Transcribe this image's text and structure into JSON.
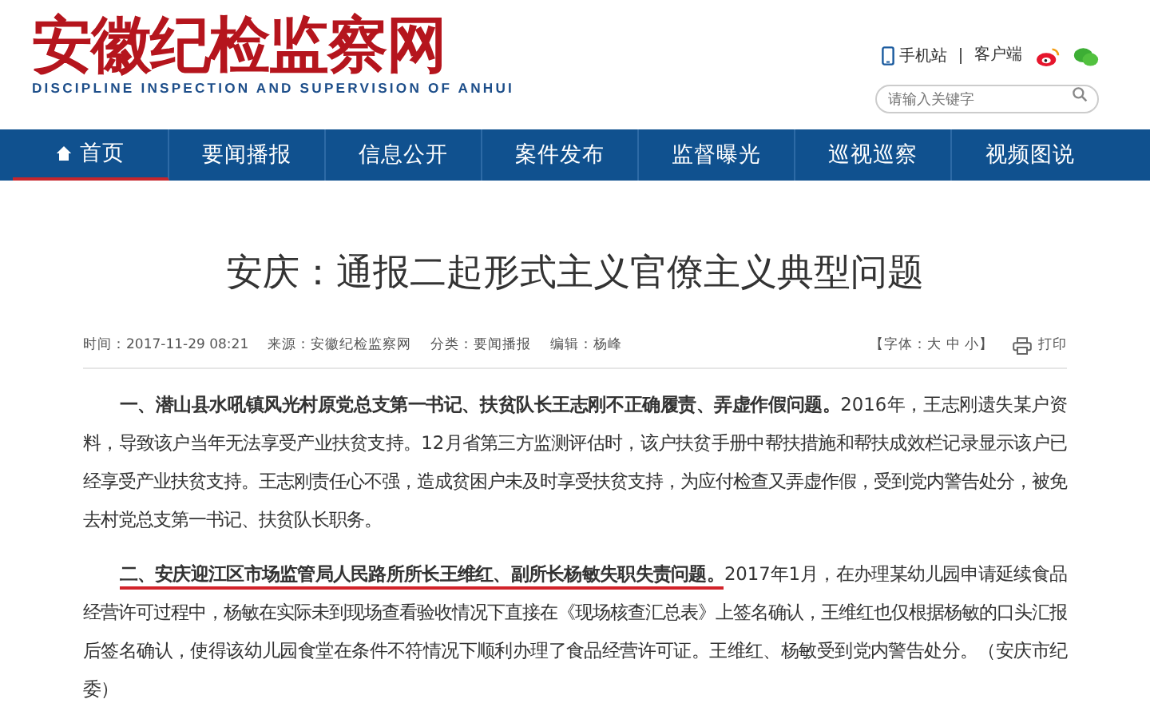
{
  "site": {
    "name": "安徽纪检监察网",
    "subtitle": "DISCIPLINE INSPECTION AND SUPERVISION OF ANHUI"
  },
  "top_links": [
    {
      "kind": "phone",
      "label": "手机站"
    },
    {
      "kind": "text",
      "label": "客户端"
    },
    {
      "kind": "weibo"
    },
    {
      "kind": "wechat"
    }
  ],
  "search": {
    "placeholder": "请输入关键字"
  },
  "nav": [
    {
      "label": "首页",
      "selected": true,
      "home": true
    },
    {
      "label": "要闻播报",
      "selected": false
    },
    {
      "label": "信息公开",
      "selected": false
    },
    {
      "label": "案件发布",
      "selected": false
    },
    {
      "label": "监督曝光",
      "selected": false
    },
    {
      "label": "巡视巡察",
      "selected": false
    },
    {
      "label": "视频图说",
      "selected": false
    }
  ],
  "article": {
    "title": "安庆：通报二起形式主义官僚主义典型问题",
    "meta": [
      "时间：2017-11-29 08:21",
      "来源：安徽纪检监察网",
      "分类：要闻播报",
      "编辑：杨峰"
    ],
    "font_size": "【字体：大 中 小】",
    "print": "打印",
    "paragraphs": [
      {
        "lead": "一、潜山县水吼镇风光村原党总支第一书记、扶贫队长王志刚不正确履责、弄虚作假问题。",
        "marked": false,
        "body": "2016年，王志刚遗失某户资料，导致该户当年无法享受产业扶贫支持。12月省第三方监测评估时，该户扶贫手册中帮扶措施和帮扶成效栏记录显示该户已经享受产业扶贫支持。王志刚责任心不强，造成贫困户未及时享受扶贫支持，为应付检查又弄虚作假，受到党内警告处分，被免去村党总支第一书记、扶贫队长职务。"
      },
      {
        "lead": "二、安庆迎江区市场监管局人民路所所长王维红、副所长杨敏失职失责问题。",
        "marked": true,
        "body": "2017年1月，在办理某幼儿园申请延续食品经营许可过程中，杨敏在实际未到现场查看验收情况下直接在《现场核查汇总表》上签名确认，王维红也仅根据杨敏的口头汇报后签名确认，使得该幼儿园食堂在条件不符情况下顺利办理了食品经营许可证。王维红、杨敏受到党内警告处分。（安庆市纪委）"
      }
    ]
  }
}
